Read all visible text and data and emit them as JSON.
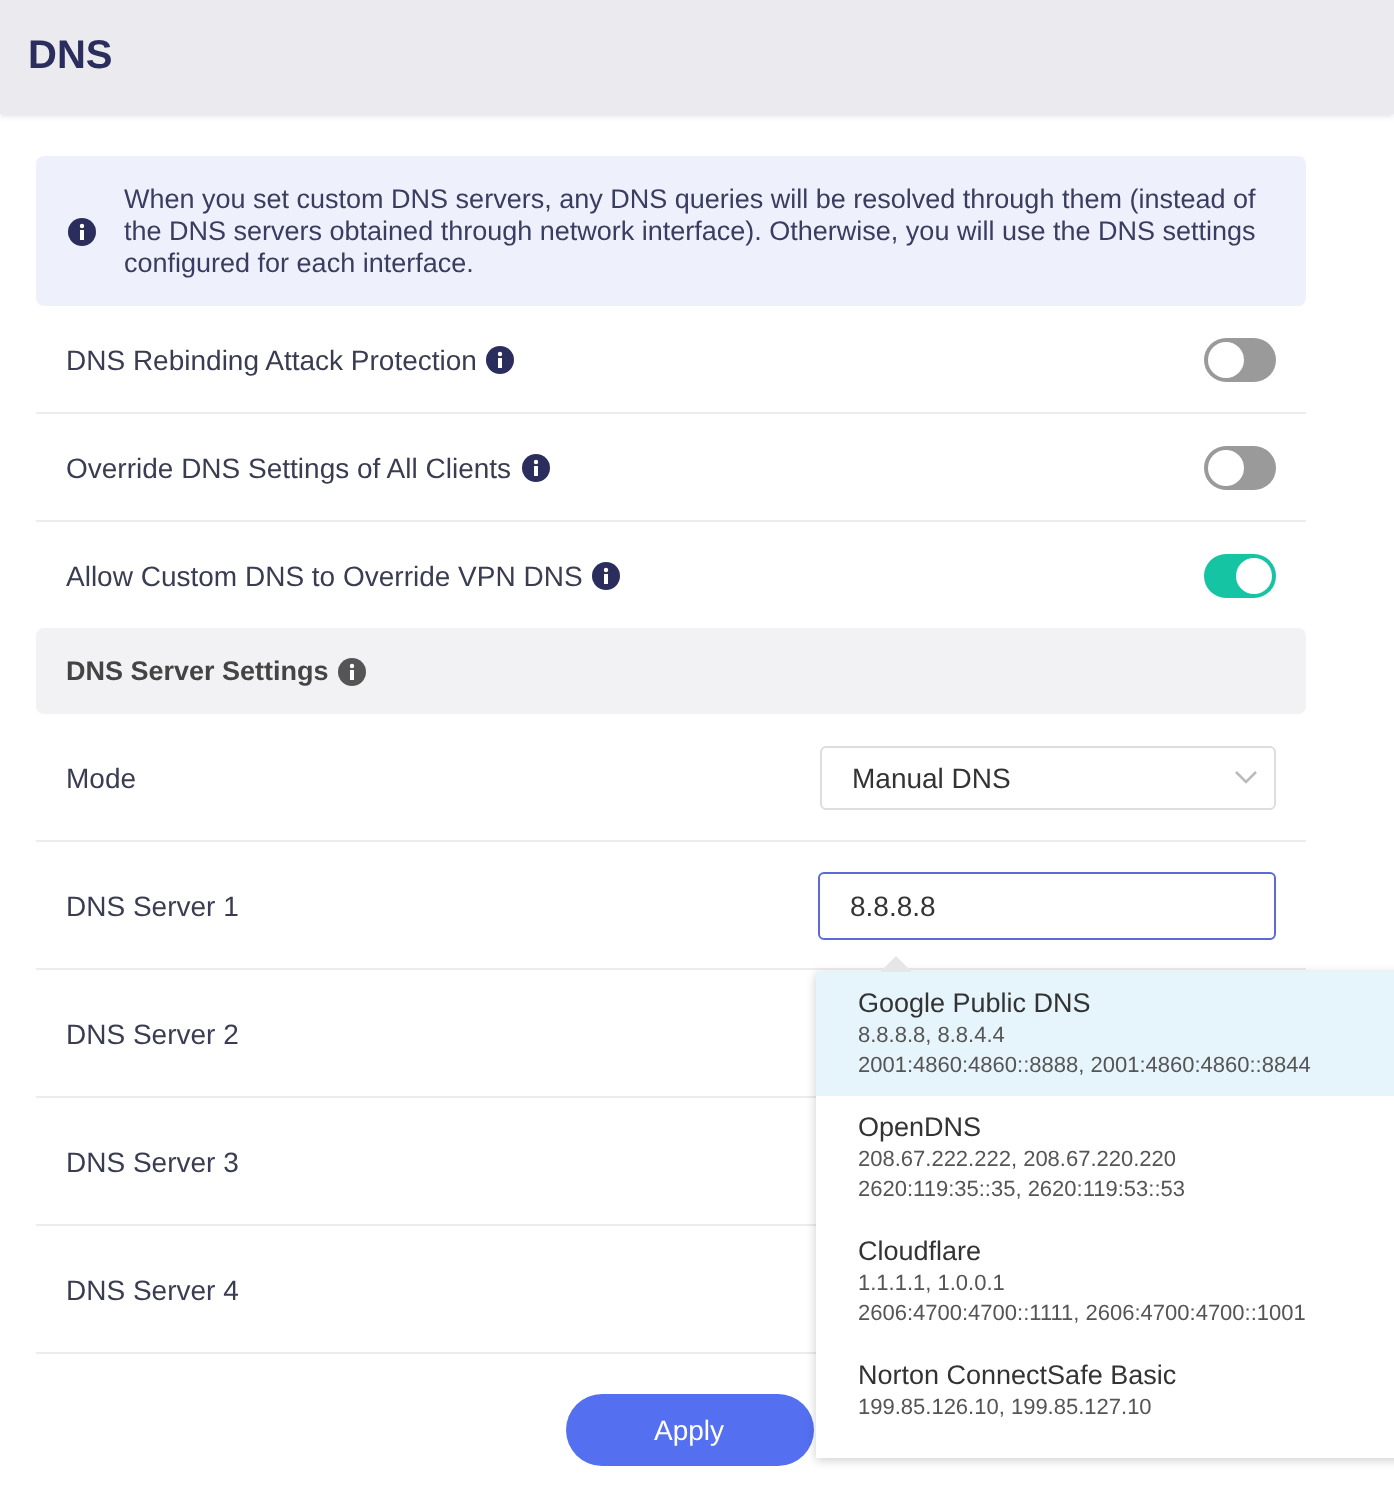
{
  "header": {
    "title": "DNS"
  },
  "notice": "When you set custom DNS servers, any DNS queries will be resolved through them (instead of the DNS servers obtained through network interface). Otherwise, you will use the DNS settings configured for each interface.",
  "toggles": [
    {
      "label": "DNS Rebinding Attack Protection",
      "on": false
    },
    {
      "label": "Override DNS Settings of All Clients",
      "on": false
    },
    {
      "label": "Allow Custom DNS to Override VPN DNS",
      "on": true
    }
  ],
  "section": {
    "title": "DNS Server Settings"
  },
  "mode": {
    "label": "Mode",
    "value": "Manual DNS"
  },
  "servers": [
    {
      "label": "DNS Server 1",
      "value": "8.8.8.8"
    },
    {
      "label": "DNS Server 2"
    },
    {
      "label": "DNS Server 3"
    },
    {
      "label": "DNS Server 4"
    }
  ],
  "suggestions": [
    {
      "name": "Google Public DNS",
      "lines": [
        "8.8.8.8, 8.8.4.4",
        "2001:4860:4860::8888, 2001:4860:4860::8844"
      ],
      "selected": true
    },
    {
      "name": "OpenDNS",
      "lines": [
        "208.67.222.222, 208.67.220.220",
        "2620:119:35::35, 2620:119:53::53"
      ],
      "selected": false
    },
    {
      "name": "Cloudflare",
      "lines": [
        "1.1.1.1, 1.0.0.1",
        "2606:4700:4700::1111, 2606:4700:4700::1001"
      ],
      "selected": false
    },
    {
      "name": "Norton ConnectSafe Basic",
      "lines": [
        "199.85.126.10, 199.85.127.10"
      ],
      "selected": false
    }
  ],
  "apply_button": "Apply"
}
